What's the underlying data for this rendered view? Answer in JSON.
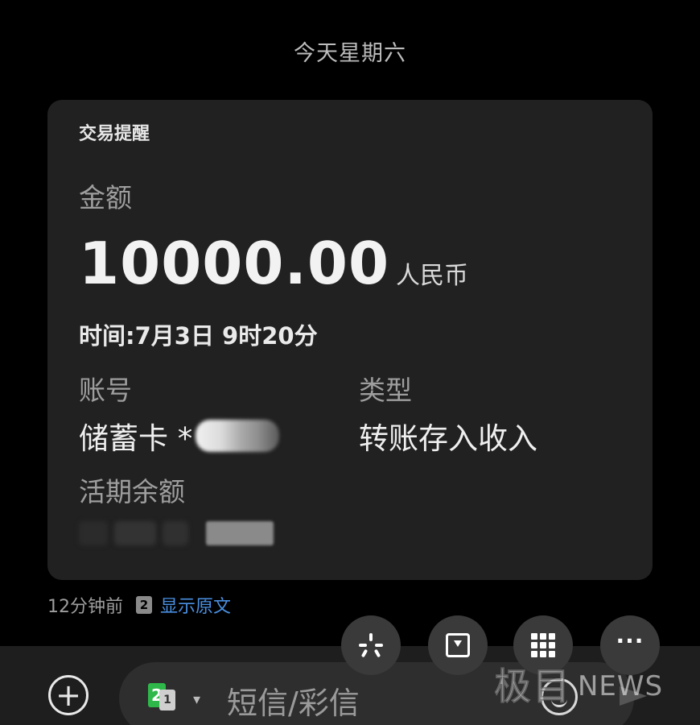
{
  "header": {
    "date_label": "今天星期六"
  },
  "message_card": {
    "title": "交易提醒",
    "amount_label": "金额",
    "amount_value": "10000.00",
    "currency": "人民币",
    "time_line": "时间:7月3日 9时20分",
    "account_label": "账号",
    "account_value": "储蓄卡 *",
    "type_label": "类型",
    "type_value": "转账存入收入",
    "balance_label": "活期余额"
  },
  "meta": {
    "time_ago": "12分钟前",
    "sim_number": "2",
    "show_original": "显示原文"
  },
  "compose_bar": {
    "placeholder": "短信/彩信",
    "sim_primary": "2",
    "sim_secondary": "1"
  },
  "quick_actions": [
    {
      "icon": "spark-icon"
    },
    {
      "icon": "download-icon"
    },
    {
      "icon": "grid-icon"
    },
    {
      "icon": "more-icon"
    }
  ],
  "watermark": {
    "logo_text": "极目",
    "news_text": "NEWS"
  },
  "colors": {
    "background": "#000000",
    "card": "#212121",
    "link": "#4a90e2",
    "sim_green": "#2eb84a"
  }
}
